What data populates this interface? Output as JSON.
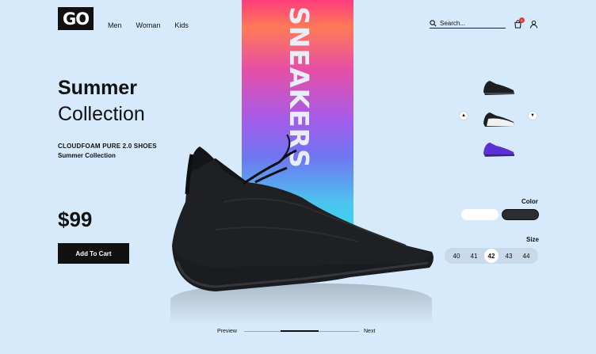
{
  "header": {
    "logo": "GO",
    "nav": [
      "Men",
      "Woman",
      "Kids"
    ],
    "search_placeholder": "Search...",
    "cart_count": "1"
  },
  "banner": {
    "text": "SNEAKERS"
  },
  "hero": {
    "title_bold": "Summer",
    "title_light": "Collection",
    "product_name": "CLOUDFOAM PURE 2.0 SHOES",
    "product_sub": "Summer Collection",
    "price": "$99",
    "add_to_cart": "Add To Cart"
  },
  "options": {
    "color_label": "Color",
    "colors": [
      "#ffffff",
      "#2a2d33"
    ],
    "size_label": "Size",
    "sizes": [
      "40",
      "41",
      "42",
      "43",
      "44"
    ],
    "selected_size": "42"
  },
  "pager": {
    "prev": "Preview",
    "next": "Next"
  },
  "icons": [
    "search-icon",
    "cart-icon",
    "user-icon",
    "arrow-up-icon",
    "arrow-down-icon"
  ]
}
